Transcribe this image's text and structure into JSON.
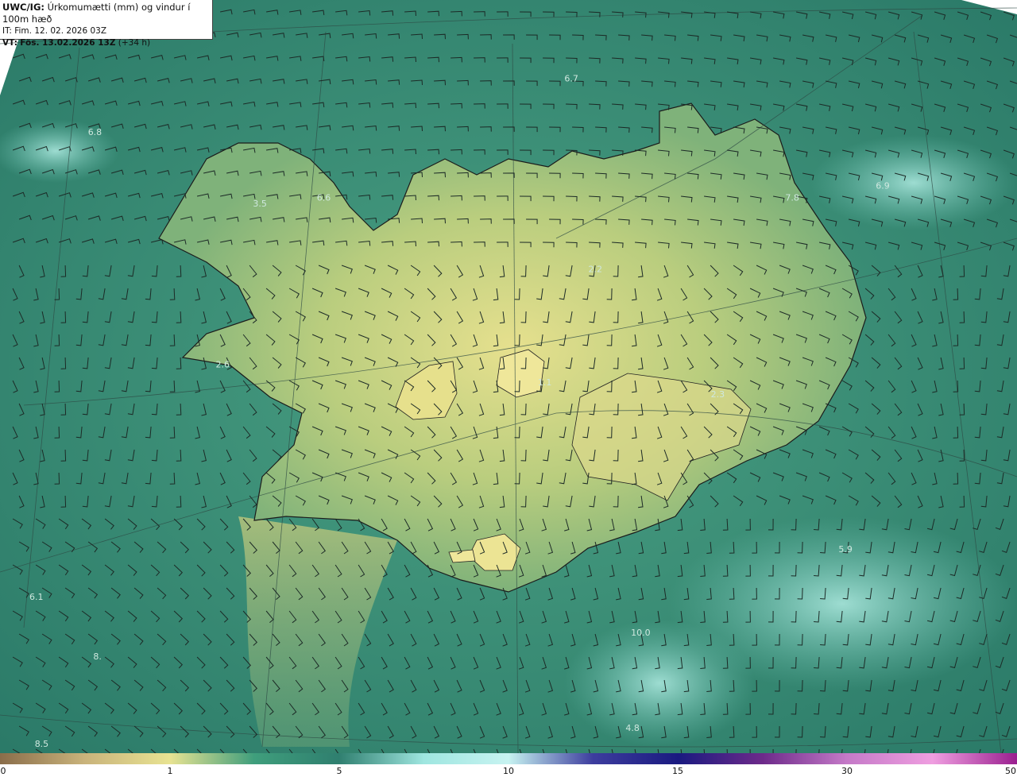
{
  "header": {
    "model": "UWC/IG:",
    "title": "Úrkomumætti (mm) og vindur í 100m hæð",
    "init_time": "IT: Fim. 12. 02. 2026 03Z",
    "valid_label": "VT:",
    "valid_time": "Fös. 13.02.2026 13Z",
    "lead": "(+34 h)"
  },
  "value_labels": [
    {
      "text": "6.7",
      "lon": -17.45,
      "lat": 67.35
    },
    {
      "text": "6.8",
      "lon": -26.4,
      "lat": 66.9
    },
    {
      "text": "3.5",
      "lon": -23.3,
      "lat": 66.3
    },
    {
      "text": "6.6",
      "lon": -22.1,
      "lat": 66.35
    },
    {
      "text": "6.9",
      "lon": -11.6,
      "lat": 66.45
    },
    {
      "text": "7.8",
      "lon": -13.3,
      "lat": 66.35
    },
    {
      "text": "2.2",
      "lon": -17.0,
      "lat": 65.75
    },
    {
      "text": "2.6",
      "lon": -24.0,
      "lat": 64.95
    },
    {
      "text": "1.1",
      "lon": -17.95,
      "lat": 64.8
    },
    {
      "text": "2.3",
      "lon": -14.7,
      "lat": 64.7
    },
    {
      "text": "5.9",
      "lon": -12.3,
      "lat": 63.4
    },
    {
      "text": "6.1",
      "lon": -27.5,
      "lat": 63.0
    },
    {
      "text": "10.0",
      "lon": -16.2,
      "lat": 62.7
    },
    {
      "text": "8.",
      "lon": -26.3,
      "lat": 62.5
    },
    {
      "text": "4.8",
      "lon": -16.3,
      "lat": 61.9
    },
    {
      "text": "8.5",
      "lon": -27.4,
      "lat": 61.6
    }
  ],
  "colorbar": {
    "unit_note": "mm",
    "ticks": [
      "0",
      "1",
      "5",
      "10",
      "15",
      "30",
      "50"
    ],
    "colors": [
      "#8a6d4a",
      "#c9b37b",
      "#e8e392",
      "#3f9e7c",
      "#2f7f6f",
      "#9fe6e0",
      "#c7f3f1",
      "#3d3d9e",
      "#1a1a80",
      "#6d2a8a",
      "#c57ac8",
      "#ef9ee0",
      "#9a1f8f"
    ]
  }
}
